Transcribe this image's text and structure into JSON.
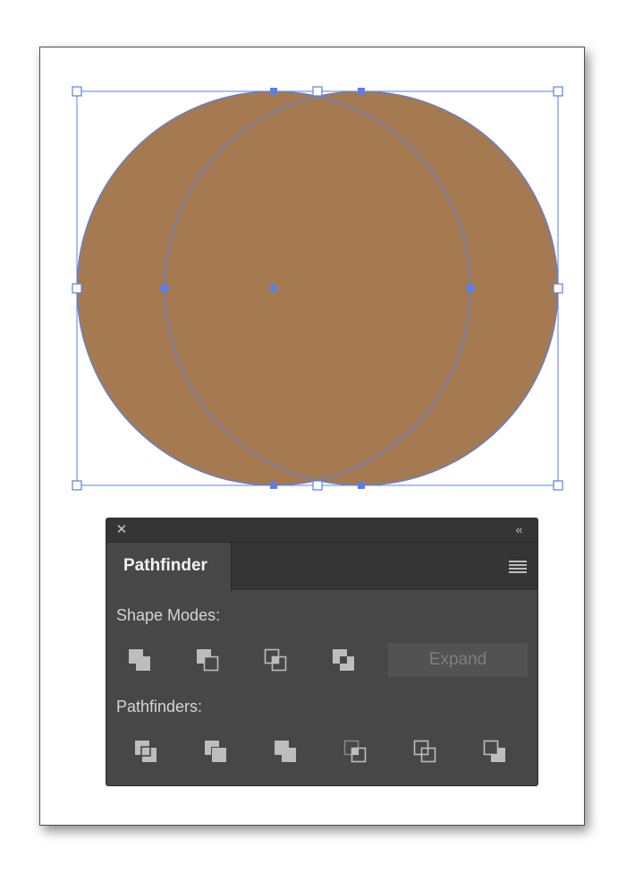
{
  "artwork": {
    "fill_color": "#a57a50",
    "selection_color": "#5b7fe6"
  },
  "pathfinder_panel": {
    "close_glyph": "✕",
    "collapse_glyph": "‹‹",
    "tab_title": "Pathfinder",
    "menu_icon": "hamburger-menu-icon",
    "shape_modes_label": "Shape Modes:",
    "shape_modes": [
      {
        "name": "unite",
        "icon": "unite-icon"
      },
      {
        "name": "minus-front",
        "icon": "minus-front-icon"
      },
      {
        "name": "intersect",
        "icon": "intersect-icon"
      },
      {
        "name": "exclude",
        "icon": "exclude-icon"
      }
    ],
    "expand_label": "Expand",
    "pathfinders_label": "Pathfinders:",
    "pathfinders": [
      {
        "name": "divide",
        "icon": "divide-icon"
      },
      {
        "name": "trim",
        "icon": "trim-icon"
      },
      {
        "name": "merge",
        "icon": "merge-icon"
      },
      {
        "name": "crop",
        "icon": "crop-icon"
      },
      {
        "name": "outline",
        "icon": "outline-icon"
      },
      {
        "name": "minus-back",
        "icon": "minus-back-icon"
      }
    ],
    "colors": {
      "panel_bg": "#474747",
      "tab_bar_bg": "#353535",
      "icon_gray": "#bdbdbd"
    }
  }
}
